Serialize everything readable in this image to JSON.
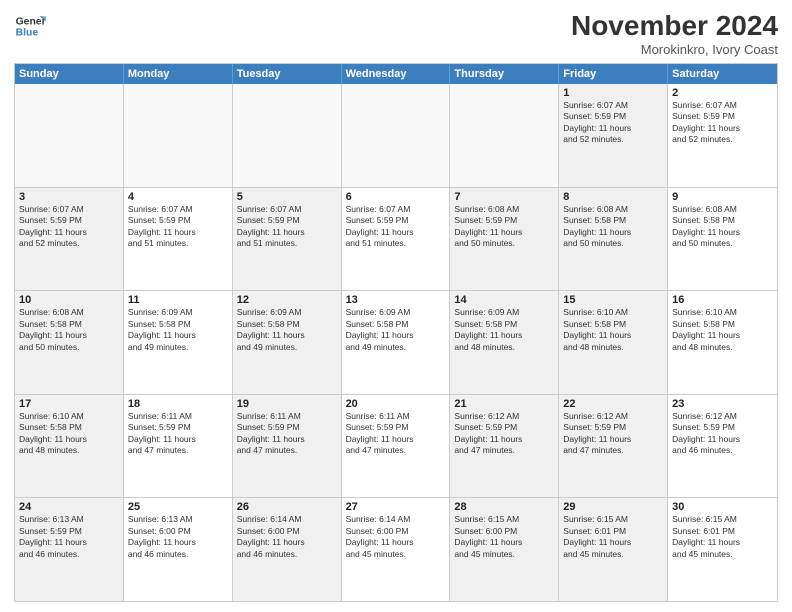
{
  "header": {
    "logo_line1": "General",
    "logo_line2": "Blue",
    "month": "November 2024",
    "location": "Morokinkro, Ivory Coast"
  },
  "weekdays": [
    "Sunday",
    "Monday",
    "Tuesday",
    "Wednesday",
    "Thursday",
    "Friday",
    "Saturday"
  ],
  "rows": [
    [
      {
        "day": "",
        "info": "",
        "empty": true
      },
      {
        "day": "",
        "info": "",
        "empty": true
      },
      {
        "day": "",
        "info": "",
        "empty": true
      },
      {
        "day": "",
        "info": "",
        "empty": true
      },
      {
        "day": "",
        "info": "",
        "empty": true
      },
      {
        "day": "1",
        "info": "Sunrise: 6:07 AM\nSunset: 5:59 PM\nDaylight: 11 hours\nand 52 minutes.",
        "shaded": true
      },
      {
        "day": "2",
        "info": "Sunrise: 6:07 AM\nSunset: 5:59 PM\nDaylight: 11 hours\nand 52 minutes."
      }
    ],
    [
      {
        "day": "3",
        "info": "Sunrise: 6:07 AM\nSunset: 5:59 PM\nDaylight: 11 hours\nand 52 minutes.",
        "shaded": true
      },
      {
        "day": "4",
        "info": "Sunrise: 6:07 AM\nSunset: 5:59 PM\nDaylight: 11 hours\nand 51 minutes."
      },
      {
        "day": "5",
        "info": "Sunrise: 6:07 AM\nSunset: 5:59 PM\nDaylight: 11 hours\nand 51 minutes.",
        "shaded": true
      },
      {
        "day": "6",
        "info": "Sunrise: 6:07 AM\nSunset: 5:59 PM\nDaylight: 11 hours\nand 51 minutes."
      },
      {
        "day": "7",
        "info": "Sunrise: 6:08 AM\nSunset: 5:59 PM\nDaylight: 11 hours\nand 50 minutes.",
        "shaded": true
      },
      {
        "day": "8",
        "info": "Sunrise: 6:08 AM\nSunset: 5:58 PM\nDaylight: 11 hours\nand 50 minutes.",
        "shaded": true
      },
      {
        "day": "9",
        "info": "Sunrise: 6:08 AM\nSunset: 5:58 PM\nDaylight: 11 hours\nand 50 minutes."
      }
    ],
    [
      {
        "day": "10",
        "info": "Sunrise: 6:08 AM\nSunset: 5:58 PM\nDaylight: 11 hours\nand 50 minutes.",
        "shaded": true
      },
      {
        "day": "11",
        "info": "Sunrise: 6:09 AM\nSunset: 5:58 PM\nDaylight: 11 hours\nand 49 minutes."
      },
      {
        "day": "12",
        "info": "Sunrise: 6:09 AM\nSunset: 5:58 PM\nDaylight: 11 hours\nand 49 minutes.",
        "shaded": true
      },
      {
        "day": "13",
        "info": "Sunrise: 6:09 AM\nSunset: 5:58 PM\nDaylight: 11 hours\nand 49 minutes."
      },
      {
        "day": "14",
        "info": "Sunrise: 6:09 AM\nSunset: 5:58 PM\nDaylight: 11 hours\nand 48 minutes.",
        "shaded": true
      },
      {
        "day": "15",
        "info": "Sunrise: 6:10 AM\nSunset: 5:58 PM\nDaylight: 11 hours\nand 48 minutes.",
        "shaded": true
      },
      {
        "day": "16",
        "info": "Sunrise: 6:10 AM\nSunset: 5:58 PM\nDaylight: 11 hours\nand 48 minutes."
      }
    ],
    [
      {
        "day": "17",
        "info": "Sunrise: 6:10 AM\nSunset: 5:58 PM\nDaylight: 11 hours\nand 48 minutes.",
        "shaded": true
      },
      {
        "day": "18",
        "info": "Sunrise: 6:11 AM\nSunset: 5:59 PM\nDaylight: 11 hours\nand 47 minutes."
      },
      {
        "day": "19",
        "info": "Sunrise: 6:11 AM\nSunset: 5:59 PM\nDaylight: 11 hours\nand 47 minutes.",
        "shaded": true
      },
      {
        "day": "20",
        "info": "Sunrise: 6:11 AM\nSunset: 5:59 PM\nDaylight: 11 hours\nand 47 minutes."
      },
      {
        "day": "21",
        "info": "Sunrise: 6:12 AM\nSunset: 5:59 PM\nDaylight: 11 hours\nand 47 minutes.",
        "shaded": true
      },
      {
        "day": "22",
        "info": "Sunrise: 6:12 AM\nSunset: 5:59 PM\nDaylight: 11 hours\nand 47 minutes.",
        "shaded": true
      },
      {
        "day": "23",
        "info": "Sunrise: 6:12 AM\nSunset: 5:59 PM\nDaylight: 11 hours\nand 46 minutes."
      }
    ],
    [
      {
        "day": "24",
        "info": "Sunrise: 6:13 AM\nSunset: 5:59 PM\nDaylight: 11 hours\nand 46 minutes.",
        "shaded": true
      },
      {
        "day": "25",
        "info": "Sunrise: 6:13 AM\nSunset: 6:00 PM\nDaylight: 11 hours\nand 46 minutes."
      },
      {
        "day": "26",
        "info": "Sunrise: 6:14 AM\nSunset: 6:00 PM\nDaylight: 11 hours\nand 46 minutes.",
        "shaded": true
      },
      {
        "day": "27",
        "info": "Sunrise: 6:14 AM\nSunset: 6:00 PM\nDaylight: 11 hours\nand 45 minutes."
      },
      {
        "day": "28",
        "info": "Sunrise: 6:15 AM\nSunset: 6:00 PM\nDaylight: 11 hours\nand 45 minutes.",
        "shaded": true
      },
      {
        "day": "29",
        "info": "Sunrise: 6:15 AM\nSunset: 6:01 PM\nDaylight: 11 hours\nand 45 minutes.",
        "shaded": true
      },
      {
        "day": "30",
        "info": "Sunrise: 6:15 AM\nSunset: 6:01 PM\nDaylight: 11 hours\nand 45 minutes."
      }
    ]
  ]
}
